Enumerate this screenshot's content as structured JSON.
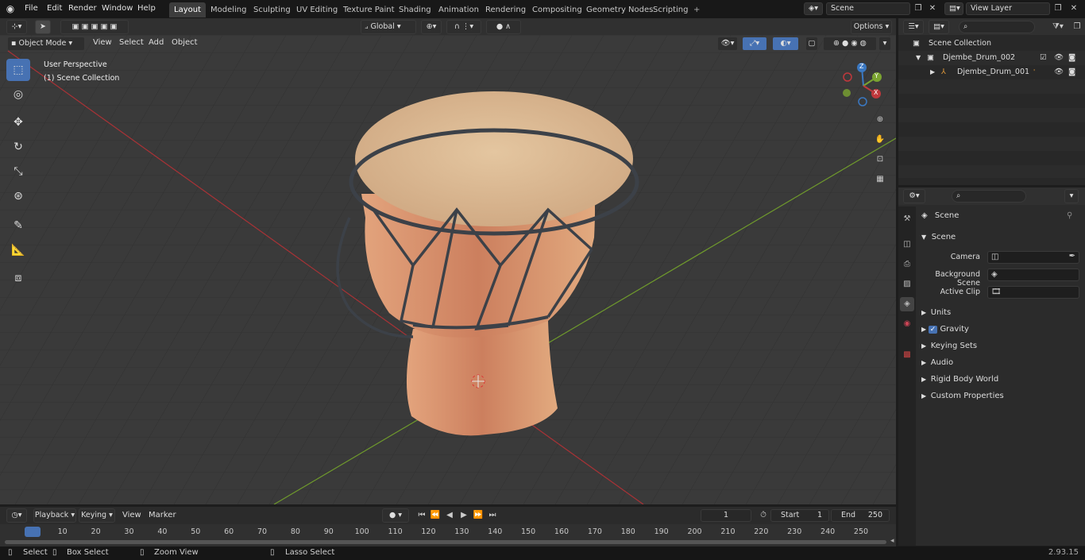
{
  "menus": [
    "File",
    "Edit",
    "Render",
    "Window",
    "Help"
  ],
  "workspaces": [
    "Layout",
    "Modeling",
    "Sculpting",
    "UV Editing",
    "Texture Paint",
    "Shading",
    "Animation",
    "Rendering",
    "Compositing",
    "Geometry Nodes",
    "Scripting"
  ],
  "scene_name": "Scene",
  "view_layer": "View Layer",
  "viewport_header": {
    "mode": "Object Mode",
    "menus": [
      "View",
      "Select",
      "Add",
      "Object"
    ],
    "orientation": "Global",
    "options": "Options"
  },
  "overlay": {
    "perspective": "User Perspective",
    "collection": "(1) Scene Collection"
  },
  "gizmo": {
    "z": "Z",
    "y": "Y",
    "x": "X"
  },
  "outliner": {
    "root": "Scene Collection",
    "items": [
      {
        "label": "Djembe_Drum_002"
      },
      {
        "label": "Djembe_Drum_001"
      }
    ]
  },
  "properties": {
    "context": "Scene",
    "panel": "Scene",
    "fields": [
      {
        "label": "Camera"
      },
      {
        "label": "Background Scene"
      },
      {
        "label": "Active Clip"
      }
    ],
    "subpanels": [
      "Units",
      "Gravity",
      "Keying Sets",
      "Audio",
      "Rigid Body World",
      "Custom Properties"
    ]
  },
  "timeline": {
    "menus": [
      "Playback",
      "Keying",
      "View",
      "Marker"
    ],
    "current_frame": "1",
    "start_label": "Start",
    "start": "1",
    "end_label": "End",
    "end": "250",
    "ticks": [
      "1",
      "10",
      "20",
      "30",
      "40",
      "50",
      "60",
      "70",
      "80",
      "90",
      "100",
      "110",
      "120",
      "130",
      "140",
      "150",
      "160",
      "170",
      "180",
      "190",
      "200",
      "210",
      "220",
      "230",
      "240",
      "250"
    ]
  },
  "statusbar": {
    "select": "Select",
    "box_select": "Box Select",
    "zoom_view": "Zoom View",
    "lasso_select": "Lasso Select",
    "version": "2.93.15"
  },
  "colors": {
    "accent": "#4772b3",
    "x_axis": "#c0383c",
    "y_axis": "#7ba431",
    "drum_skin": "#e0bf98",
    "drum_body": "#d99570",
    "rope": "#3c4148"
  }
}
